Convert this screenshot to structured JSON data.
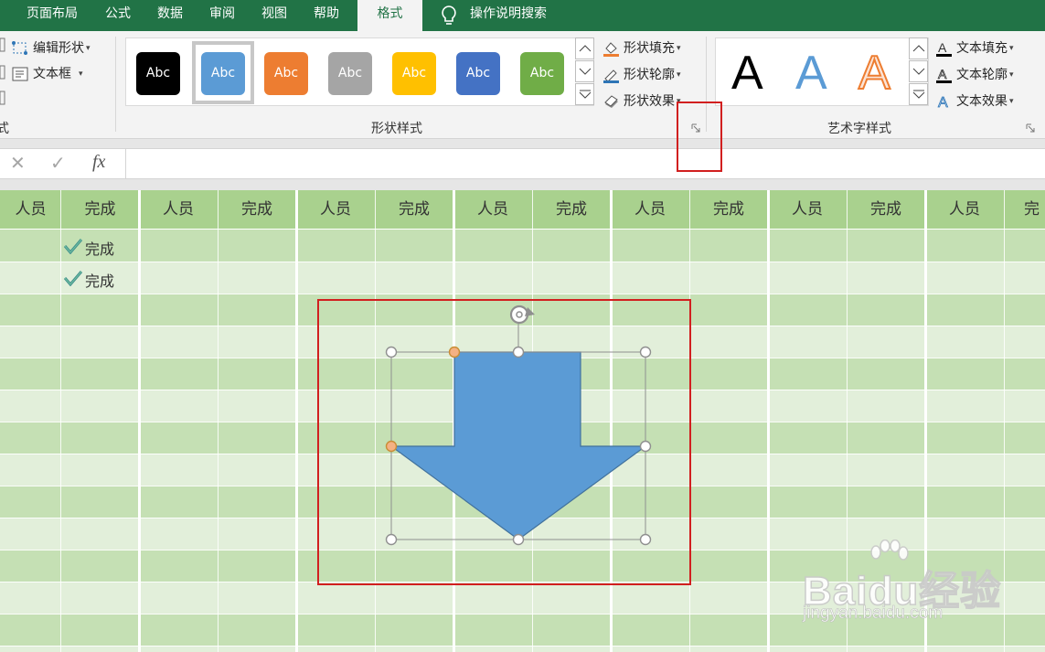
{
  "tabs": [
    {
      "label": "　"
    },
    {
      "label": "页面布局"
    },
    {
      "label": "公式"
    },
    {
      "label": "数据"
    },
    {
      "label": "审阅"
    },
    {
      "label": "视图"
    },
    {
      "label": "帮助"
    },
    {
      "label": "格式"
    }
  ],
  "tell_me": "操作说明搜索",
  "ribbon": {
    "insert_group": {
      "edit_shape": "编辑形状",
      "text_box": "文本框",
      "label_fragment": "式"
    },
    "shape_styles": {
      "label": "形状样式",
      "swatch_text": "Abc",
      "swatches": [
        {
          "color": "#000000"
        },
        {
          "color": "#5b9bd5"
        },
        {
          "color": "#ed7d31"
        },
        {
          "color": "#a5a5a5"
        },
        {
          "color": "#ffc000"
        },
        {
          "color": "#4472c4"
        },
        {
          "color": "#70ad47"
        }
      ],
      "fill": "形状填充",
      "outline": "形状轮廓",
      "effects": "形状效果"
    },
    "wordart": {
      "label": "艺术字样式",
      "letter": "A",
      "text_fill": "文本填充",
      "text_outline": "文本轮廓",
      "text_effects": "文本效果"
    }
  },
  "formula_bar": {
    "cancel": "✕",
    "enter": "✓",
    "fx": "fx",
    "value": ""
  },
  "sheet": {
    "header_cells": [
      "人员",
      "完成",
      "人员",
      "完成",
      "人员",
      "完成",
      "人员",
      "完成",
      "人员",
      "完成",
      "人员",
      "完成",
      "人员",
      "完"
    ],
    "cells": [
      {
        "text": "完成"
      },
      {
        "text": "完成"
      }
    ]
  },
  "colors": {
    "ribbon_green": "#217346",
    "header_green": "#a9d18e",
    "row_dark": "#c5e0b4",
    "row_light": "#e2efda",
    "shape_fill": "#5b9bd5",
    "annotation_red": "#d11f1f"
  },
  "watermark": {
    "brand": "Baidu经验",
    "url": "jingyan.baidu.com"
  }
}
